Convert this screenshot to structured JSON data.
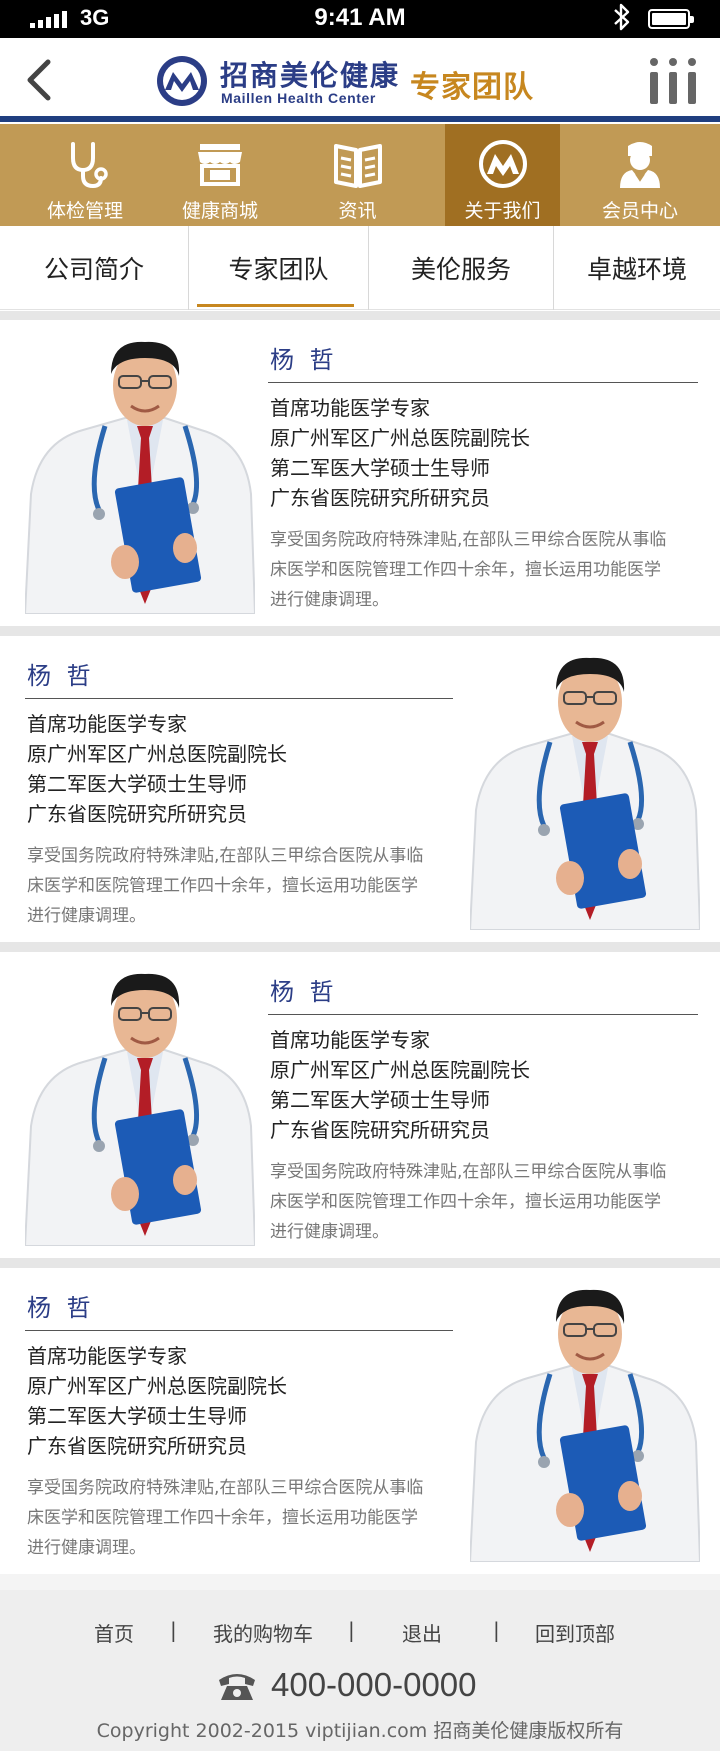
{
  "status_bar": {
    "network": "3G",
    "time": "9:41 AM"
  },
  "header": {
    "brand_cn": "招商美伦健康",
    "brand_en": "Maillen Health Center",
    "page_title": "专家团队"
  },
  "main_nav": [
    {
      "label": "体检管理",
      "icon": "stethoscope-icon"
    },
    {
      "label": "健康商城",
      "icon": "store-icon"
    },
    {
      "label": "资讯",
      "icon": "book-icon"
    },
    {
      "label": "关于我们",
      "icon": "brand-logo-icon",
      "active": true
    },
    {
      "label": "会员中心",
      "icon": "doctor-avatar-icon"
    }
  ],
  "sub_nav": [
    {
      "label": "公司简介"
    },
    {
      "label": "专家团队",
      "active": true
    },
    {
      "label": "美伦服务"
    },
    {
      "label": "卓越环境"
    }
  ],
  "doctors": [
    {
      "name": "杨 哲",
      "titles": [
        "首席功能医学专家",
        "原广州军区广州总医院副院长",
        "第二军医大学硕士生导师",
        "广东省医院研究所研究员"
      ],
      "desc": [
        "享受国务院政府特殊津贴,在部队三甲综合医院从事临",
        "床医学和医院管理工作四十余年，擅长运用功能医学",
        "进行健康调理。"
      ]
    },
    {
      "name": "杨 哲",
      "titles": [
        "首席功能医学专家",
        "原广州军区广州总医院副院长",
        "第二军医大学硕士生导师",
        "广东省医院研究所研究员"
      ],
      "desc": [
        "享受国务院政府特殊津贴,在部队三甲综合医院从事临",
        "床医学和医院管理工作四十余年，擅长运用功能医学",
        "进行健康调理。"
      ]
    },
    {
      "name": "杨 哲",
      "titles": [
        "首席功能医学专家",
        "原广州军区广州总医院副院长",
        "第二军医大学硕士生导师",
        "广东省医院研究所研究员"
      ],
      "desc": [
        "享受国务院政府特殊津贴,在部队三甲综合医院从事临",
        "床医学和医院管理工作四十余年，擅长运用功能医学",
        "进行健康调理。"
      ]
    },
    {
      "name": "杨 哲",
      "titles": [
        "首席功能医学专家",
        "原广州军区广州总医院副院长",
        "第二军医大学硕士生导师",
        "广东省医院研究所研究员"
      ],
      "desc": [
        "享受国务院政府特殊津贴,在部队三甲综合医院从事临",
        "床医学和医院管理工作四十余年，擅长运用功能医学",
        "进行健康调理。"
      ]
    }
  ],
  "footer": {
    "links": [
      "首页",
      "我的购物车",
      "退出",
      "回到顶部"
    ],
    "separator": "|",
    "phone": "400-000-0000",
    "copyright": "Copyright 2002-2015 viptijian.com  招商美伦健康版权所有"
  },
  "colors": {
    "brand_blue": "#2b3d86",
    "gold": "#c19a55",
    "gold_active": "#a06f22",
    "accent": "#c7871f"
  }
}
